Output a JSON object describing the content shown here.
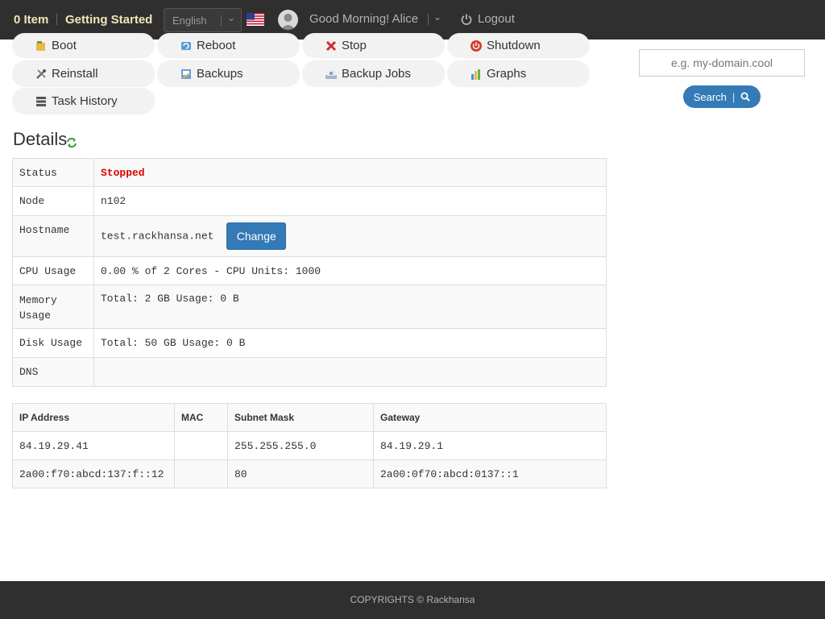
{
  "topbar": {
    "cart": "0 Item",
    "getting_started": "Getting Started",
    "language": "English",
    "greeting": "Good Morning! Alice",
    "logout": "Logout"
  },
  "actions": [
    {
      "label": "Boot",
      "icon": "boot-icon"
    },
    {
      "label": "Reboot",
      "icon": "reboot-icon"
    },
    {
      "label": "Stop",
      "icon": "stop-icon"
    },
    {
      "label": "Shutdown",
      "icon": "shutdown-icon"
    },
    {
      "label": "Reinstall",
      "icon": "tools-icon"
    },
    {
      "label": "Backups",
      "icon": "backup-icon"
    },
    {
      "label": "Backup Jobs",
      "icon": "backup-jobs-icon"
    },
    {
      "label": "Graphs",
      "icon": "graph-icon"
    },
    {
      "label": "Task History",
      "icon": "list-icon"
    }
  ],
  "search": {
    "placeholder": "e.g. my-domain.cool",
    "button": "Search"
  },
  "details": {
    "title": "Details",
    "rows": [
      {
        "key": "Status",
        "value": "Stopped"
      },
      {
        "key": "Node",
        "value": "n102"
      },
      {
        "key": "Hostname",
        "value": "test.rackhansa.net",
        "button": "Change"
      },
      {
        "key": "CPU Usage",
        "value": "0.00 % of 2 Cores - CPU Units: 1000"
      },
      {
        "key": "Memory Usage",
        "value": "Total: 2 GB Usage: 0 B"
      },
      {
        "key": "Disk Usage",
        "value": "Total: 50 GB Usage: 0 B"
      },
      {
        "key": "DNS",
        "value": ""
      }
    ]
  },
  "ip_table": {
    "headers": [
      "IP Address",
      "MAC",
      "Subnet Mask",
      "Gateway"
    ],
    "rows": [
      [
        "84.19.29.41",
        "",
        "255.255.255.0",
        "84.19.29.1"
      ],
      [
        "2a00:f70:abcd:137:f::12",
        "",
        "80",
        "2a00:0f70:abcd:0137::1"
      ]
    ]
  },
  "footer": "COPYRIGHTS © Rackhansa",
  "colors": {
    "topbar_bg": "#2f2f2f",
    "accent": "#337ab7",
    "status_stopped": "#dd0000"
  }
}
